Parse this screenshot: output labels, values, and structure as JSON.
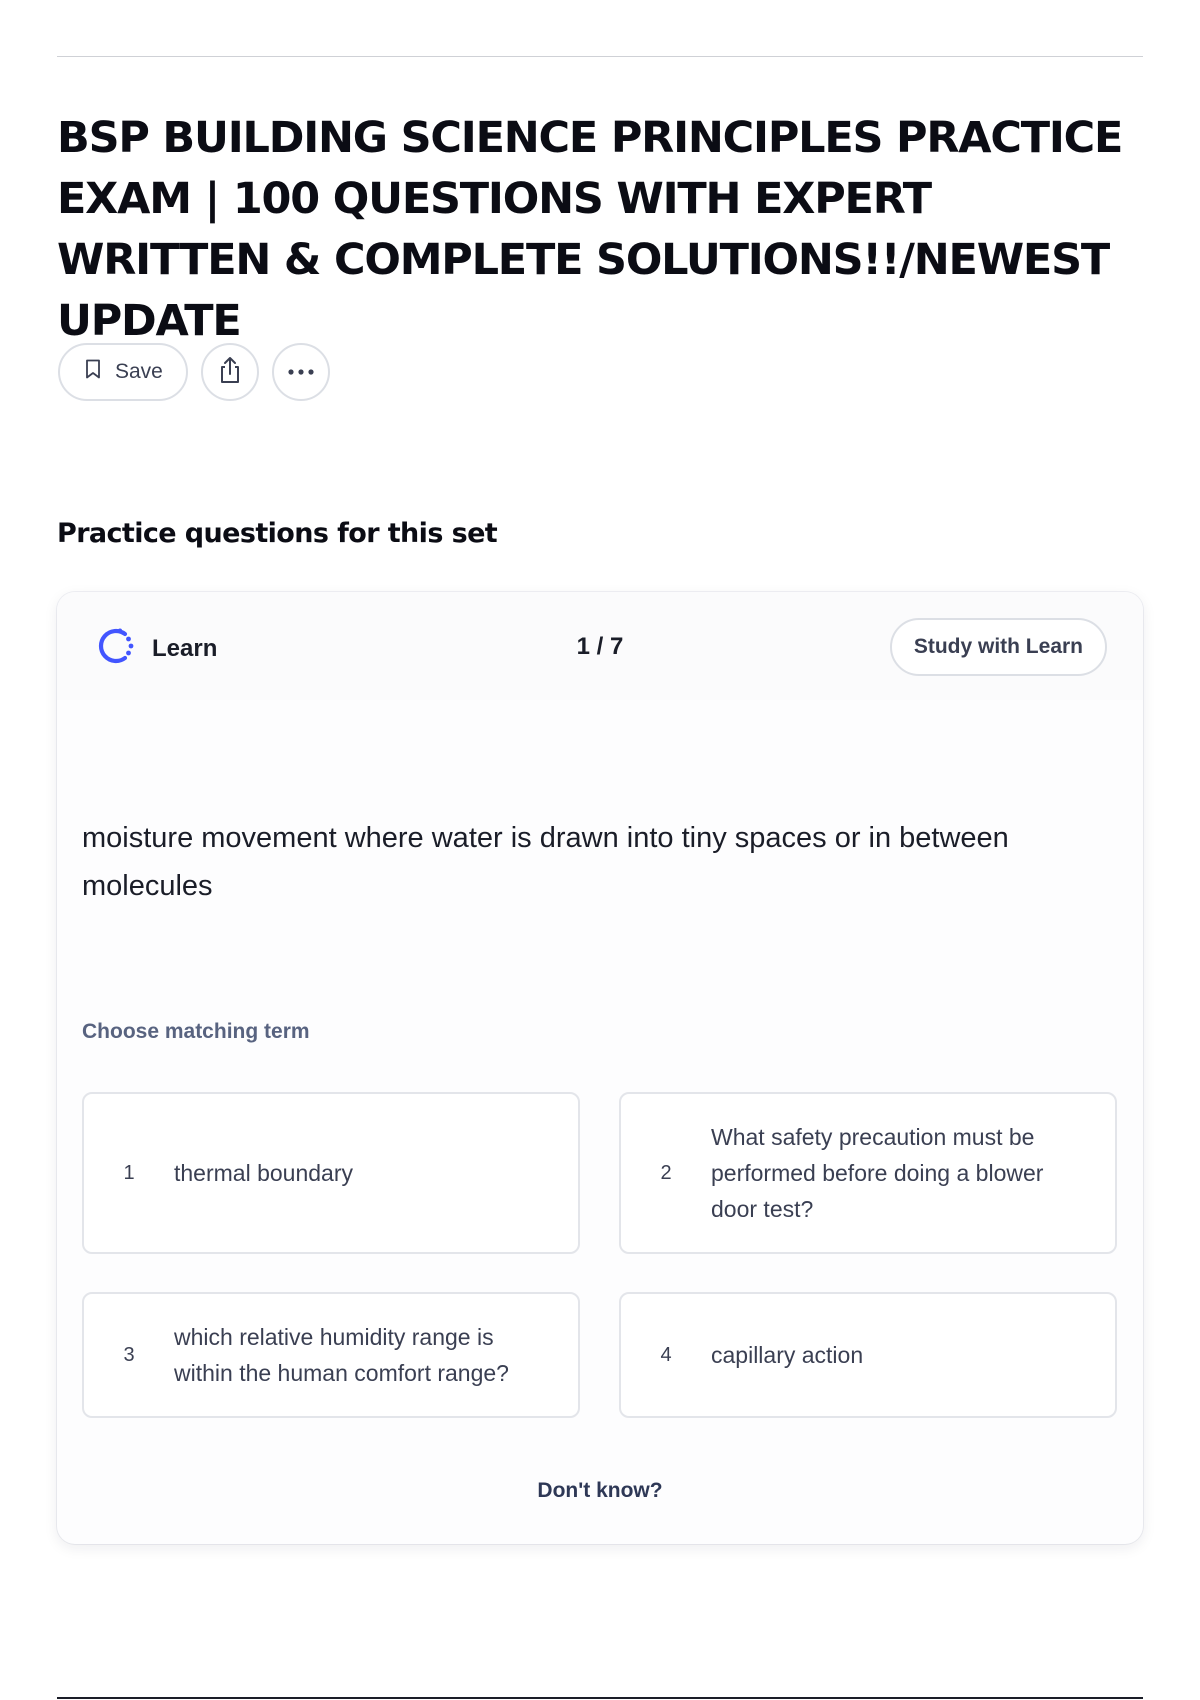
{
  "document": {
    "title": "BSP BUILDING SCIENCE PRINCIPLES PRACTICE EXAM | 100 QUESTIONS WITH EXPERT WRITTEN & COMPLETE SOLUTIONS!!/NEWEST UPDATE"
  },
  "actions": {
    "save_label": "Save",
    "share_icon": "share-icon",
    "more_icon": "more-icon"
  },
  "practice": {
    "heading": "Practice questions for this set",
    "mode_label": "Learn",
    "progress": "1 / 7",
    "study_button": "Study with Learn",
    "prompt": "moisture movement where water is drawn into tiny spaces or in between molecules",
    "instruction": "Choose matching term",
    "options": [
      {
        "number": "1",
        "text": "thermal boundary"
      },
      {
        "number": "2",
        "text": "What safety precaution must be performed before doing a blower door test?"
      },
      {
        "number": "3",
        "text": "which relative humidity range is within the human comfort range?"
      },
      {
        "number": "4",
        "text": "capillary action"
      }
    ],
    "dont_know": "Don't know?"
  },
  "colors": {
    "learn_icon": "#4255ff",
    "muted_text": "#586380",
    "link_text": "#2e3856"
  }
}
